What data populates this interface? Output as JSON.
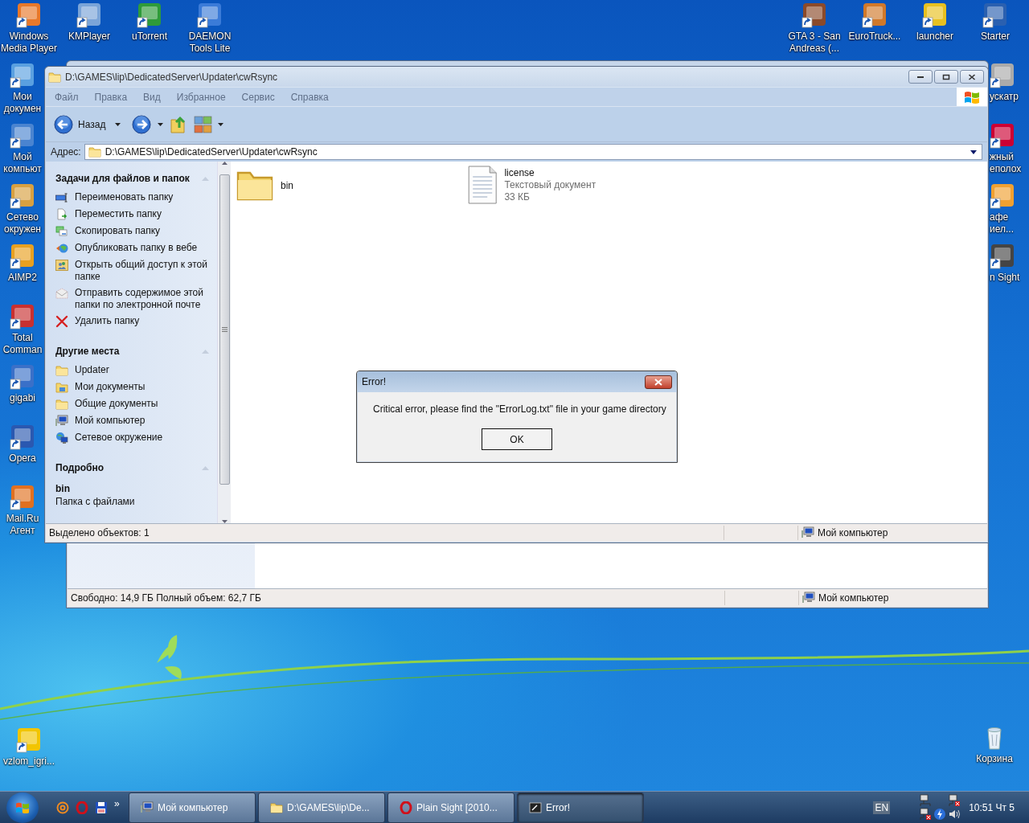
{
  "desktop": {
    "top_icons": [
      {
        "label": "Windows Media Player"
      },
      {
        "label": "KMPlayer"
      },
      {
        "label": "uTorrent"
      },
      {
        "label": "DAEMON Tools Lite"
      }
    ],
    "top_right_icons": [
      {
        "label": "GTA 3 - San Andreas (..."
      },
      {
        "label": "EuroTruck..."
      },
      {
        "label": "launcher"
      },
      {
        "label": "Starter"
      }
    ],
    "left_icons": [
      {
        "label": "Мои докумен"
      },
      {
        "label": "Мой компьют"
      },
      {
        "label": "Сетево окружен"
      },
      {
        "label": "AIMP2"
      },
      {
        "label": "Total Comman"
      },
      {
        "label": "gigabi"
      },
      {
        "label": "Opera"
      },
      {
        "label": "Mail.Ru Агент"
      }
    ],
    "right_icons": [
      {
        "label": "ускатр"
      },
      {
        "label": "жный еполох"
      },
      {
        "label": "афе иел..."
      },
      {
        "label": "n Sight"
      }
    ],
    "bottom_left_icons": [
      {
        "label": "vzlom_igri..."
      }
    ],
    "bottom_right_icons": [
      {
        "label": "Корзина"
      }
    ]
  },
  "back_window": {
    "status_bar": {
      "left": "Свободно: 14,9 ГБ Полный объем: 62,7 ГБ",
      "zone": "Мой компьютер"
    }
  },
  "explorer": {
    "title": "D:\\GAMES\\lip\\DedicatedServer\\Updater\\cwRsync",
    "menu": {
      "disabled": true,
      "items": [
        "Файл",
        "Правка",
        "Вид",
        "Избранное",
        "Сервис",
        "Справка"
      ]
    },
    "toolbar": {
      "back": "Назад"
    },
    "address": {
      "label": "Адрес:",
      "value": "D:\\GAMES\\lip\\DedicatedServer\\Updater\\cwRsync"
    },
    "task_pane": {
      "sections": [
        {
          "title": "Задачи для файлов и папок",
          "items": [
            {
              "label": "Переименовать папку",
              "kind": "rename"
            },
            {
              "label": "Переместить папку",
              "kind": "move"
            },
            {
              "label": "Скопировать папку",
              "kind": "copy"
            },
            {
              "label": "Опубликовать папку в вебе",
              "kind": "publish"
            },
            {
              "label": "Открыть общий доступ к этой папке",
              "kind": "share"
            },
            {
              "label": "Отправить содержимое этой папки по электронной почте",
              "kind": "email"
            },
            {
              "label": "Удалить папку",
              "kind": "delete"
            }
          ]
        },
        {
          "title": "Другие места",
          "items": [
            {
              "label": "Updater",
              "kind": "folder"
            },
            {
              "label": "Мои документы",
              "kind": "docs"
            },
            {
              "label": "Общие документы",
              "kind": "folder"
            },
            {
              "label": "Мой компьютер",
              "kind": "computer"
            },
            {
              "label": "Сетевое окружение",
              "kind": "network"
            }
          ]
        },
        {
          "title": "Подробно",
          "details": {
            "name": "bin",
            "type": "Папка с файлами"
          }
        }
      ]
    },
    "files": [
      {
        "name": "bin",
        "kind": "folder"
      },
      {
        "name": "license",
        "kind": "text",
        "type": "Текстовый документ",
        "size": "33 КБ"
      }
    ],
    "status_bar": {
      "left": "Выделено объектов: 1",
      "zone": "Мой компьютер"
    }
  },
  "dialog": {
    "title": "Error!",
    "message": "Critical error, please find the \"ErrorLog.txt\" file in your game directory",
    "button": "OK"
  },
  "taskbar": {
    "more": "»",
    "buttons": [
      {
        "label": "Мой компьютер",
        "kind": "computer",
        "selected": false
      },
      {
        "label": "D:\\GAMES\\lip\\De...",
        "kind": "folder",
        "selected": false
      },
      {
        "label": "Plain Sight [2010...",
        "kind": "opera",
        "selected": false
      },
      {
        "label": "Error!",
        "kind": "app",
        "selected": true
      }
    ],
    "language": "EN",
    "clock": "10:51 Чт 5"
  }
}
